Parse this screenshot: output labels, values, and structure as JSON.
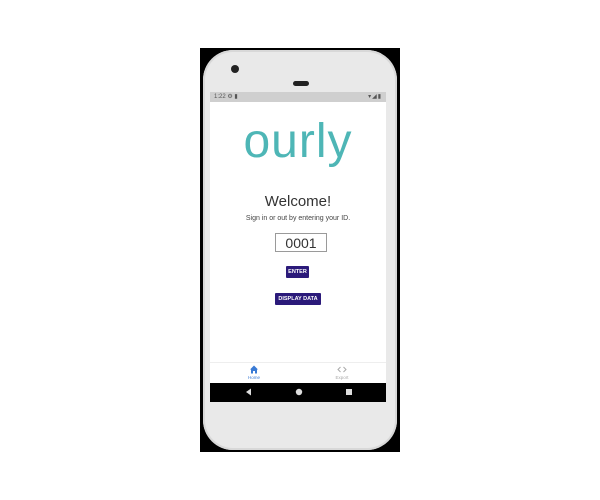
{
  "status_bar": {
    "time": "1:22",
    "left_icons": "⚙ ▮",
    "right_icons": "▾◢▮"
  },
  "app": {
    "logo": "ourly",
    "welcome": "Welcome!",
    "subtitle": "Sign in or out by entering your ID.",
    "id_field": {
      "value": "0001"
    },
    "enter_button": "ENTER",
    "display_button": "DISPLAY DATA"
  },
  "bottom_nav": {
    "items": [
      {
        "label": "Home",
        "icon": "home-icon",
        "active": true
      },
      {
        "label": "Export",
        "icon": "code-icon",
        "active": false
      }
    ]
  },
  "colors": {
    "logo": "#4eb6b6",
    "button": "#2b1a7a",
    "active_tab": "#3a7bd5"
  }
}
